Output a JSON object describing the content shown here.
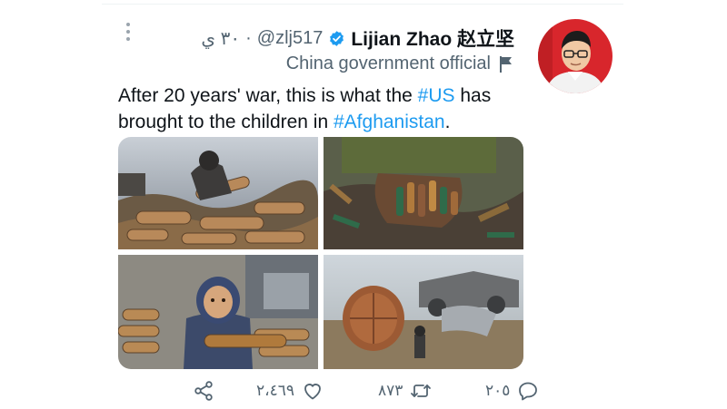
{
  "tweet": {
    "time": "٣٠ ي",
    "handle": "@zlj517",
    "dot": "·",
    "name": "Lijian Zhao 赵立坚",
    "affiliation": "China government official",
    "text_part1": "After 20 years' war, this is what the ",
    "hashtag1": "#US",
    "text_part2": " has brought to the children in ",
    "hashtag2": "#Afghanistan",
    "text_part3": "."
  },
  "actions": {
    "like_count": "٢،٤٦٩",
    "retweet_count": "٨٧٣",
    "reply_count": "٢٠٥"
  },
  "icons": [
    "more-icon",
    "verified-icon",
    "flag-icon",
    "share-icon",
    "heart-icon",
    "retweet-icon",
    "reply-icon"
  ],
  "colors": {
    "link": "#1d9bf0",
    "verified": "#1d9bf0",
    "muted": "#536471"
  }
}
